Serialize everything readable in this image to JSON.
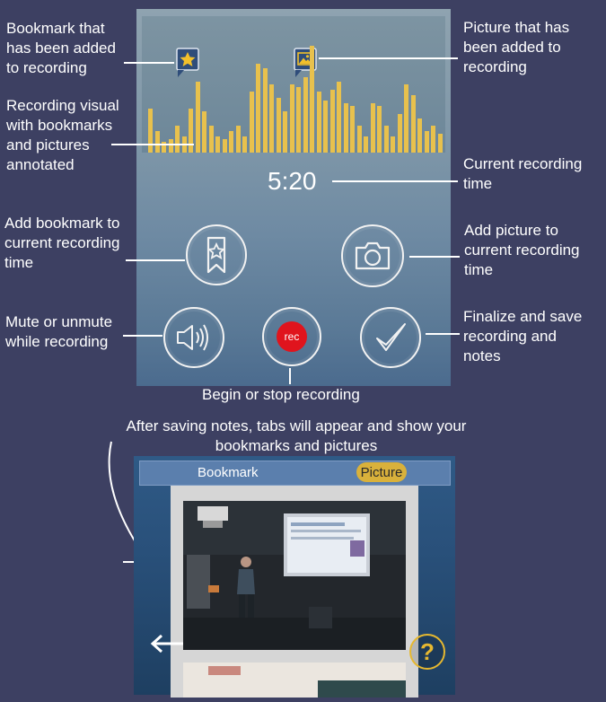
{
  "annotations": {
    "bookmark_added": "Bookmark that\nhas been added\nto recording",
    "recording_visual": "Recording visual\nwith bookmarks\nand pictures\nannotated",
    "add_bookmark": "Add bookmark to\ncurrent recording\ntime",
    "mute": "Mute or unmute\nwhile recording",
    "picture_added": "Picture that has\nbeen added to\nrecording",
    "current_time": "Current recording\ntime",
    "add_picture": "Add picture to\ncurrent recording\ntime",
    "finalize": "Finalize and save\nrecording and\nnotes",
    "begin_stop": "Begin or stop recording",
    "after_saving": "After saving notes, tabs will appear and show your\nbookmarks and pictures"
  },
  "recorder": {
    "timer": "5:20",
    "rec_label": "rec"
  },
  "waveform": {
    "bar_heights": [
      0.32,
      0.16,
      0.08,
      0.1,
      0.2,
      0.12,
      0.32,
      0.52,
      0.3,
      0.2,
      0.12,
      0.1,
      0.16,
      0.2,
      0.12,
      0.45,
      0.65,
      0.62,
      0.5,
      0.4,
      0.3,
      0.5,
      0.48,
      0.55,
      0.78,
      0.45,
      0.38,
      0.46,
      0.52,
      0.36,
      0.34,
      0.2,
      0.12,
      0.36,
      0.34,
      0.2,
      0.12,
      0.28,
      0.5,
      0.42,
      0.25,
      0.16,
      0.2,
      0.14
    ]
  },
  "saved_view": {
    "tabs": [
      {
        "label": "Bookmark"
      },
      {
        "label": "Picture"
      }
    ],
    "help_label": "?"
  },
  "colors": {
    "page_bg": "#3d4062",
    "waveform_bar": "#e8c14d",
    "rec_red": "#e0141d",
    "accent_gold": "#d9b13b"
  }
}
